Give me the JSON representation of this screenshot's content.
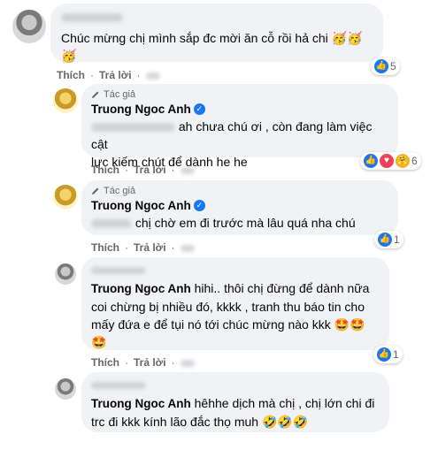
{
  "comments": [
    {
      "text": "Chúc mừng chị mình sắp đc mời ăn cỗ rồi hả chi",
      "emoji": "🥳🥳🥳",
      "actions": {
        "like": "Thích",
        "reply": "Trả lời"
      },
      "reactions": {
        "icons": [
          "like-reaction"
        ],
        "count": "5"
      }
    },
    {
      "author_tag": "Tác giả",
      "author": "Truong Ngoc Anh",
      "text_line1": "ah chưa chú ơi , còn đang làm việc cật",
      "text_line2": "lực kiếm chút để dành he he",
      "actions": {
        "like": "Thích",
        "reply": "Trả lời"
      },
      "reactions": {
        "icons": [
          "like-reaction",
          "love-reaction",
          "care-reaction"
        ],
        "count": "6"
      }
    },
    {
      "author_tag": "Tác giả",
      "author": "Truong Ngoc Anh",
      "text": "chị chờ em đi trước mà lâu quá nha chú",
      "actions": {
        "like": "Thích",
        "reply": "Trả lời"
      },
      "reactions": {
        "icons": [
          "like-reaction"
        ],
        "count": "1"
      }
    },
    {
      "mention": "Truong Ngoc Anh",
      "text_line1": " hihi.. thôi chị đừng để dành nữa",
      "text_line2": "coi chừng bị nhiều đó, kkkk , tranh thu báo tin cho",
      "text_line3": "mấy đứa e để tụi nó tới chúc mừng nào kkk",
      "emoji_inline": "🤩🤩",
      "emoji_line4": "🤩",
      "actions": {
        "like": "Thích",
        "reply": "Trả lời"
      },
      "reactions": {
        "icons": [
          "like-reaction"
        ],
        "count": "1"
      }
    },
    {
      "mention": "Truong Ngoc Anh",
      "text_line1": " hêhhe dịch mà chị , chị lớn chi đi",
      "text_line2": "trc đi kkk kính lão đắc thọ muh",
      "emoji": "🤣🤣🤣"
    }
  ]
}
